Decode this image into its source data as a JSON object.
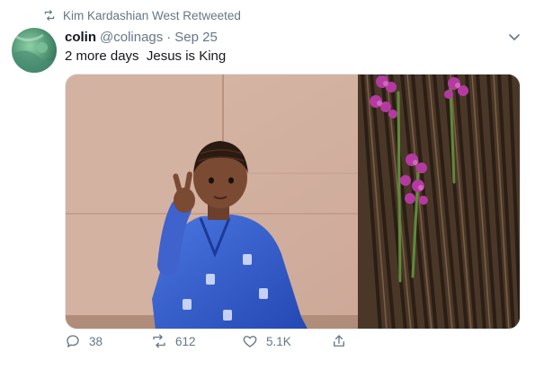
{
  "retweet_context": {
    "text": "Kim Kardashian West Retweeted",
    "icon": "retweet-icon"
  },
  "tweet": {
    "name": "colin",
    "handle": "@colinags",
    "separator": "·",
    "date": "Sep 25",
    "text": "2 more days  Jesus is King",
    "menu_icon": "chevron-down-icon"
  },
  "actions": {
    "reply": {
      "count": "38",
      "icon": "reply-icon"
    },
    "retweet": {
      "count": "612",
      "icon": "retweet-icon"
    },
    "like": {
      "count": "5.1K",
      "icon": "heart-icon"
    },
    "share": {
      "icon": "share-icon"
    }
  },
  "colors": {
    "secondary_text": "#657786",
    "primary_text": "#14171a",
    "border": "#e1e8ed",
    "avatar_green": "#5aa07c"
  }
}
